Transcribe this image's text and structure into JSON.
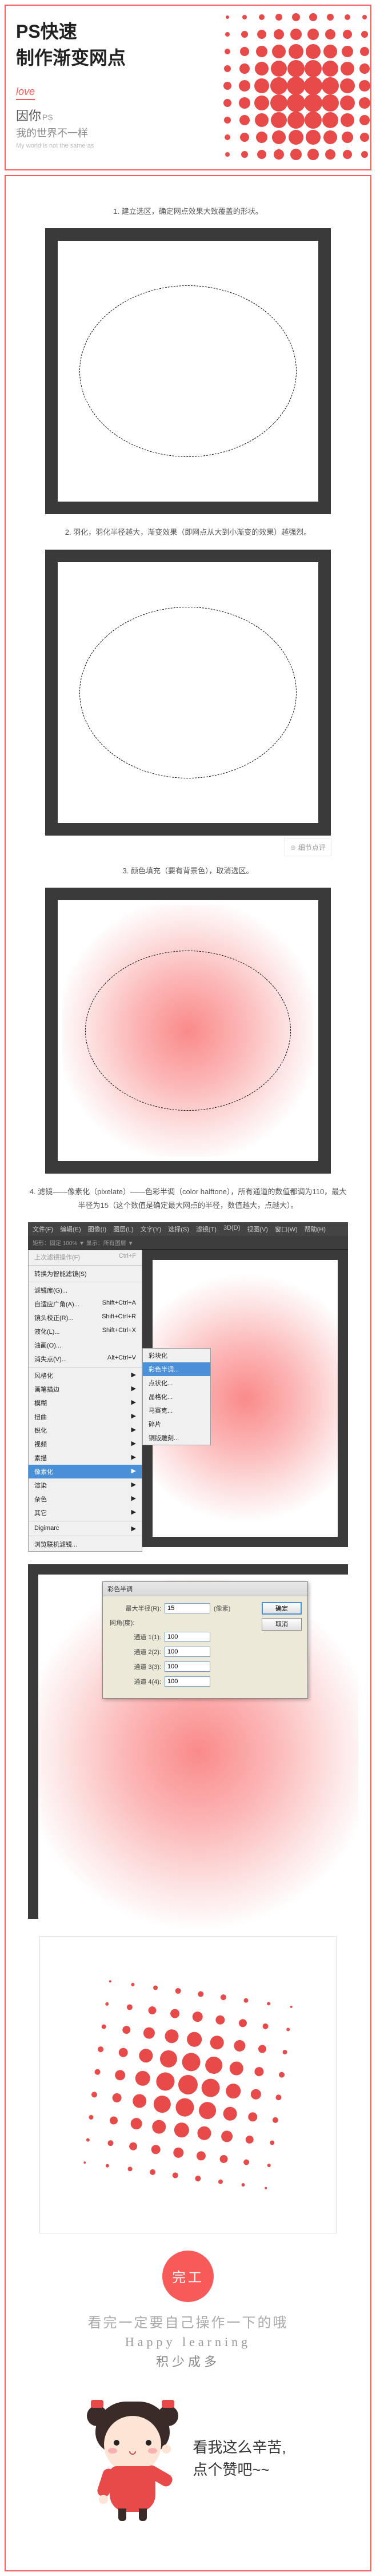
{
  "header": {
    "title_line1": "PS快速",
    "title_line2": "制作渐变网点",
    "love": "love",
    "sub1_main": "因你",
    "sub1_ps": "PS",
    "sub2": "我的世界不一样",
    "sub3": "My world is not the same as"
  },
  "steps": {
    "s1": "1. 建立选区，确定网点效果大致覆盖的形状。",
    "s2": "2. 羽化，羽化半径越大，渐变效果（即网点从大到小渐变的效果）越强烈。",
    "detail_btn": "细节点评",
    "s3": "3. 颜色填充（要有背景色），取消选区。",
    "s4": "4. 滤镜——像素化（pixelate）——色彩半调（color halftone），所有通道的数值都调为110，最大半径为15（这个数值是确定最大网点的半径，数值越大，点越大）。"
  },
  "ps_ui": {
    "menubar": [
      "文件(F)",
      "编辑(E)",
      "图像(I)",
      "图层(L)",
      "文字(Y)",
      "选择(S)",
      "滤镜(T)",
      "3D(D)",
      "视图(V)",
      "窗口(W)",
      "帮助(H)"
    ],
    "toolbar_info": "矩形：固定 100% ▼  显示：所有图层 ▼",
    "menu": {
      "last_filter": {
        "label": "上次滤镜操作(F)",
        "shortcut": "Ctrl+F"
      },
      "smart": "转换为智能滤镜(S)",
      "gallery": "滤镜库(G)...",
      "adaptive": {
        "label": "自适应广角(A)...",
        "shortcut": "Shift+Ctrl+A"
      },
      "lens": {
        "label": "镜头校正(R)...",
        "shortcut": "Shift+Ctrl+R"
      },
      "liquify": {
        "label": "液化(L)...",
        "shortcut": "Shift+Ctrl+X"
      },
      "oil": "油画(O)...",
      "vanish": {
        "label": "消失点(V)...",
        "shortcut": "Alt+Ctrl+V"
      },
      "groups": [
        "风格化",
        "画笔描边",
        "模糊",
        "扭曲",
        "锐化",
        "视频",
        "素描"
      ],
      "pixelate": "像素化",
      "groups2": [
        "渲染",
        "杂色",
        "其它"
      ],
      "digimarc": "Digimarc",
      "browse": "浏览联机滤镜..."
    },
    "submenu": {
      "items": [
        "彩块化",
        "彩色半调...",
        "点状化...",
        "晶格化...",
        "马赛克...",
        "碎片",
        "铜版雕刻..."
      ],
      "highlight": "彩色半调..."
    }
  },
  "dialog": {
    "title": "彩色半调",
    "max_radius_label": "最大半径(R):",
    "max_radius_value": "15",
    "unit": "(像素)",
    "angles_label": "网角(度):",
    "ch1_label": "通道 1(1):",
    "ch1_value": "100",
    "ch2_label": "通道 2(2):",
    "ch2_value": "100",
    "ch3_label": "通道 3(3):",
    "ch3_value": "100",
    "ch4_label": "通道 4(4):",
    "ch4_value": "100",
    "ok": "确定",
    "cancel": "取消"
  },
  "finish": {
    "badge": "完工",
    "line1": "看完一定要自己操作一下的哦",
    "line2": "Happy learning",
    "line3": "积少成多",
    "speech1": "看我这么辛苦,",
    "speech2": "点个赞吧~~"
  },
  "chart_data": null
}
